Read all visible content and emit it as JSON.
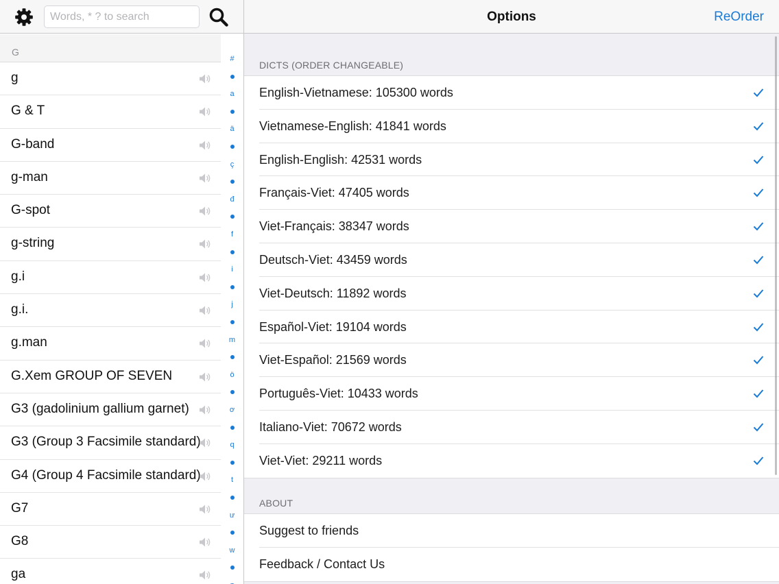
{
  "left": {
    "search": {
      "placeholder": "Words, * ? to search",
      "value": ""
    },
    "section_header": "G",
    "words": [
      "g",
      "G & T",
      "G-band",
      "g-man",
      "G-spot",
      "g-string",
      "g.i",
      "g.i.",
      "g.man",
      "G.Xem GROUP OF SEVEN",
      "G3 (gadolinium gallium garnet)",
      "G3 (Group 3 Facsimile standard)",
      "G4 (Group 4 Facsimile standard)",
      "G7",
      "G8",
      "ga"
    ],
    "index_letters": [
      "#",
      "a",
      "ä",
      "ç",
      "đ",
      "f",
      "i",
      "j",
      "m",
      "ö",
      "ơ",
      "q",
      "t",
      "ư",
      "w",
      "z"
    ],
    "icons": {
      "settings": "gear-icon",
      "search": "search-icon",
      "speaker": "speaker-icon"
    }
  },
  "right": {
    "title": "Options",
    "action_label": "ReOrder",
    "dicts_header": "DICTS (ORDER CHANGEABLE)",
    "dicts": [
      {
        "label": "English-Vietnamese: 105300 words",
        "checked": true
      },
      {
        "label": "Vietnamese-English: 41841 words",
        "checked": true
      },
      {
        "label": "English-English: 42531 words",
        "checked": true
      },
      {
        "label": "Français-Viet: 47405 words",
        "checked": true
      },
      {
        "label": "Viet-Français: 38347 words",
        "checked": true
      },
      {
        "label": "Deutsch-Viet: 43459 words",
        "checked": true
      },
      {
        "label": "Viet-Deutsch: 11892 words",
        "checked": true
      },
      {
        "label": "Español-Viet: 19104 words",
        "checked": true
      },
      {
        "label": "Viet-Español: 21569 words",
        "checked": true
      },
      {
        "label": "Português-Viet: 10433 words",
        "checked": true
      },
      {
        "label": "Italiano-Viet: 70672 words",
        "checked": true
      },
      {
        "label": "Viet-Viet: 29211 words",
        "checked": true
      }
    ],
    "about_header": "ABOUT",
    "about_items": [
      "Suggest to friends",
      "Feedback / Contact Us"
    ]
  },
  "colors": {
    "accent": "#1a7bd6",
    "separator": "#c8c7cc",
    "group_bg": "#efeff4"
  }
}
